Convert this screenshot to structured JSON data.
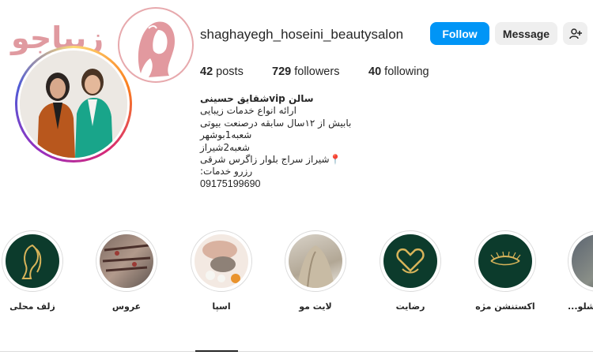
{
  "watermark": {
    "text": "زیباجو"
  },
  "profile": {
    "username": "shaghayegh_hoseini_beautysalon",
    "follow_label": "Follow",
    "message_label": "Message",
    "stats": {
      "posts_count": "42",
      "posts_label": "posts",
      "followers_count": "729",
      "followers_label": "followers",
      "following_count": "40",
      "following_label": "following"
    },
    "bio": {
      "name": "سالن vipشقایق حسینی",
      "lines": [
        "ارائه انواع خدمات زیبایی",
        "بابیش از ۱۲سال سابقه درصنعت بیوتی",
        "شعبه1بوشهر",
        "شعبه2شیراز",
        "📍شیراز سراج بلوار زاگرس شرقی",
        "رزرو خدمات:",
        "09175199690"
      ]
    }
  },
  "highlights": [
    {
      "label": "زلف محلی",
      "icon": "hair-silhouette-icon"
    },
    {
      "label": "عروس",
      "icon": "bridal-photo"
    },
    {
      "label": "اسپا",
      "icon": "spa-photo"
    },
    {
      "label": "لایت مو",
      "icon": "hair-light-photo"
    },
    {
      "label": "رضایت",
      "icon": "hands-heart-icon"
    },
    {
      "label": "اکستنشن مژه",
      "icon": "eyelash-icon"
    },
    {
      "label": "...زشلو",
      "icon": "partial-photo"
    }
  ],
  "colors": {
    "follow_bg": "#0095f6",
    "highlight_green": "#0c3b2c",
    "gold": "#d8b45a",
    "watermark_pink": "#e09aa0"
  }
}
